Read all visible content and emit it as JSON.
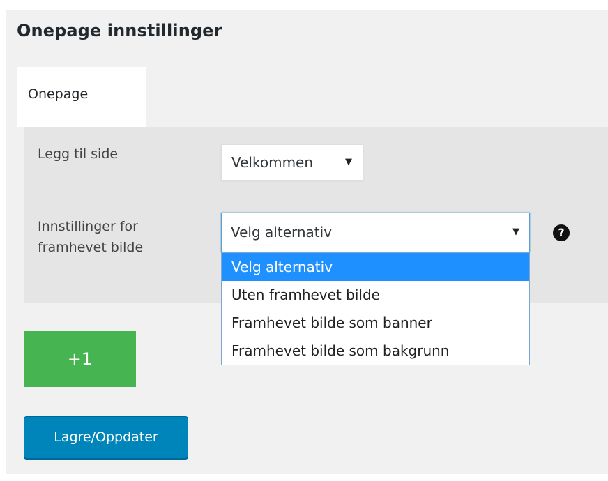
{
  "page": {
    "title": "Onepage innstillinger"
  },
  "tabs": [
    {
      "label": "Onepage",
      "active": true
    }
  ],
  "form": {
    "add_page": {
      "label": "Legg til side",
      "selected": "Velkommen"
    },
    "featured_image": {
      "label": "Innstillinger for framhevet bilde",
      "selected": "Velg alternativ",
      "help_icon": "question-circle-icon",
      "options": [
        "Velg alternativ",
        "Uten framhevet bilde",
        "Framhevet bilde som banner",
        "Framhevet bilde som bakgrunn"
      ],
      "highlighted_index": 0
    }
  },
  "buttons": {
    "add_label": "+1",
    "save_label": "Lagre/Oppdater"
  },
  "colors": {
    "add_button": "#46b450",
    "save_button": "#0085ba",
    "highlight": "#1e90ff",
    "panel": "#f1f1f1"
  }
}
